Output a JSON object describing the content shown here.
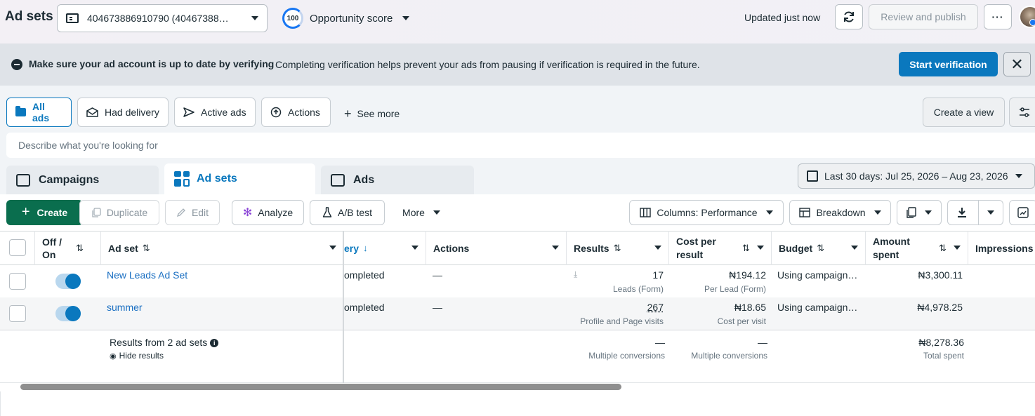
{
  "header": {
    "title": "Ad sets",
    "account": "404673886910790 (40467388…",
    "opportunity_score": "100",
    "opportunity_label": "Opportunity score",
    "updated": "Updated just now",
    "review_publish": "Review and publish",
    "more": "···"
  },
  "banner": {
    "bold": "Make sure your ad account is up to date by verifying",
    "text": "Completing verification helps prevent your ads from pausing if verification is required in the future.",
    "button": "Start verification",
    "close": "✕"
  },
  "filters": {
    "chips": [
      "All ads",
      "Had delivery",
      "Active ads",
      "Actions"
    ],
    "see_more": "See more",
    "create_view": "Create a view",
    "search_placeholder": "Describe what you're looking for"
  },
  "tabs": {
    "campaigns": "Campaigns",
    "adsets": "Ad sets",
    "ads": "Ads"
  },
  "date_range": "Last 30 days: Jul 25, 2026 – Aug 23, 2026",
  "toolbar": {
    "create": "Create",
    "duplicate": "Duplicate",
    "edit": "Edit",
    "analyze": "Analyze",
    "ab_test": "A/B test",
    "more": "More",
    "columns": "Columns: Performance",
    "breakdown": "Breakdown"
  },
  "table": {
    "headers": {
      "off_on": "Off / On",
      "ad_set": "Ad set",
      "delivery": "ery",
      "actions": "Actions",
      "results": "Results",
      "cost_per_result": "Cost per result",
      "budget": "Budget",
      "amount_spent": "Amount spent",
      "impressions": "Impressions"
    },
    "rows": [
      {
        "name": "New Leads Ad Set",
        "delivery": "ompleted",
        "actions": "—",
        "results": "17",
        "results_sub": "Leads (Form)",
        "cost": "₦194.12",
        "cost_sub": "Per Lead (Form)",
        "budget": "Using campaign…",
        "spent": "₦3,300.11",
        "on": true
      },
      {
        "name": "summer",
        "delivery": "ompleted",
        "actions": "—",
        "results": "267",
        "results_sub": "Profile and Page visits",
        "cost": "₦18.65",
        "cost_sub": "Cost per visit",
        "budget": "Using campaign…",
        "spent": "₦4,978.25",
        "on": true
      }
    ],
    "summary": {
      "label": "Results from 2 ad sets",
      "hide": "Hide results",
      "results": "—",
      "results_sub": "Multiple conversions",
      "cost": "—",
      "cost_sub": "Multiple conversions",
      "spent": "₦8,278.36",
      "spent_sub": "Total spent"
    }
  },
  "colors": {
    "accent": "#0a78be",
    "create_green": "#0a6e4e",
    "banner_bg": "#dfe3e8"
  }
}
